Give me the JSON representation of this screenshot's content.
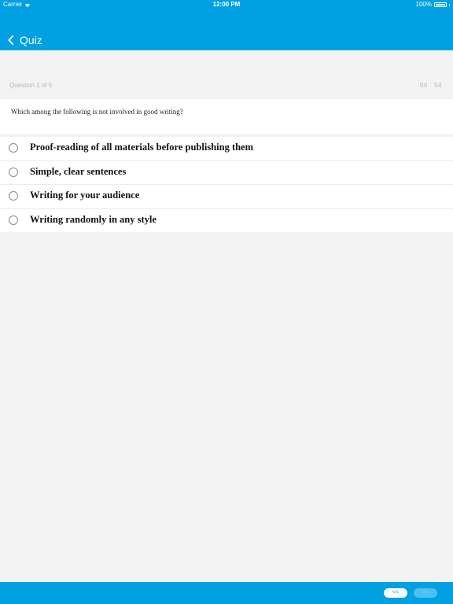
{
  "status_bar": {
    "carrier": "Carrier",
    "time": "12:00 PM",
    "battery": "100%"
  },
  "nav": {
    "title": "Quiz",
    "back_icon": "chevron-left-icon"
  },
  "quiz": {
    "progress": "Question 1 of 5",
    "timer": "00 : 54",
    "question": "Which among the following is not involved in good writing?",
    "options": [
      {
        "label": "Proof-reading of all materials before publishing them"
      },
      {
        "label": "Simple, clear sentences"
      },
      {
        "label": "Writing for your audience"
      },
      {
        "label": "Writing randomly in any style"
      }
    ]
  },
  "footer": {
    "prev_label": "<<",
    "next_label": ">>"
  },
  "colors": {
    "accent": "#00a0e2",
    "background": "#f3f3f3"
  }
}
